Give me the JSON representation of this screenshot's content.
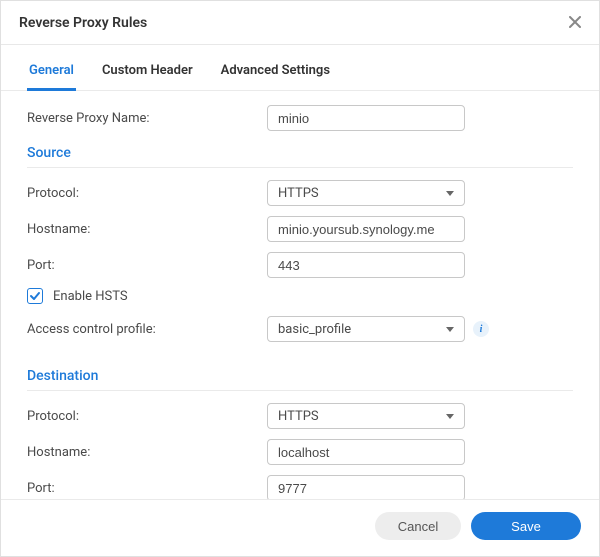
{
  "header": {
    "title": "Reverse Proxy Rules"
  },
  "tabs": {
    "general": "General",
    "custom_header": "Custom Header",
    "advanced_settings": "Advanced Settings"
  },
  "form": {
    "name_label": "Reverse Proxy Name:",
    "name_value": "minio"
  },
  "source": {
    "title": "Source",
    "protocol_label": "Protocol:",
    "protocol_value": "HTTPS",
    "hostname_label": "Hostname:",
    "hostname_value": "minio.yoursub.synology.me",
    "port_label": "Port:",
    "port_value": "443",
    "hsts_label": "Enable HSTS",
    "hsts_checked": true,
    "acp_label": "Access control profile:",
    "acp_value": "basic_profile"
  },
  "destination": {
    "title": "Destination",
    "protocol_label": "Protocol:",
    "protocol_value": "HTTPS",
    "hostname_label": "Hostname:",
    "hostname_value": "localhost",
    "port_label": "Port:",
    "port_value": "9777"
  },
  "footer": {
    "cancel": "Cancel",
    "save": "Save"
  }
}
